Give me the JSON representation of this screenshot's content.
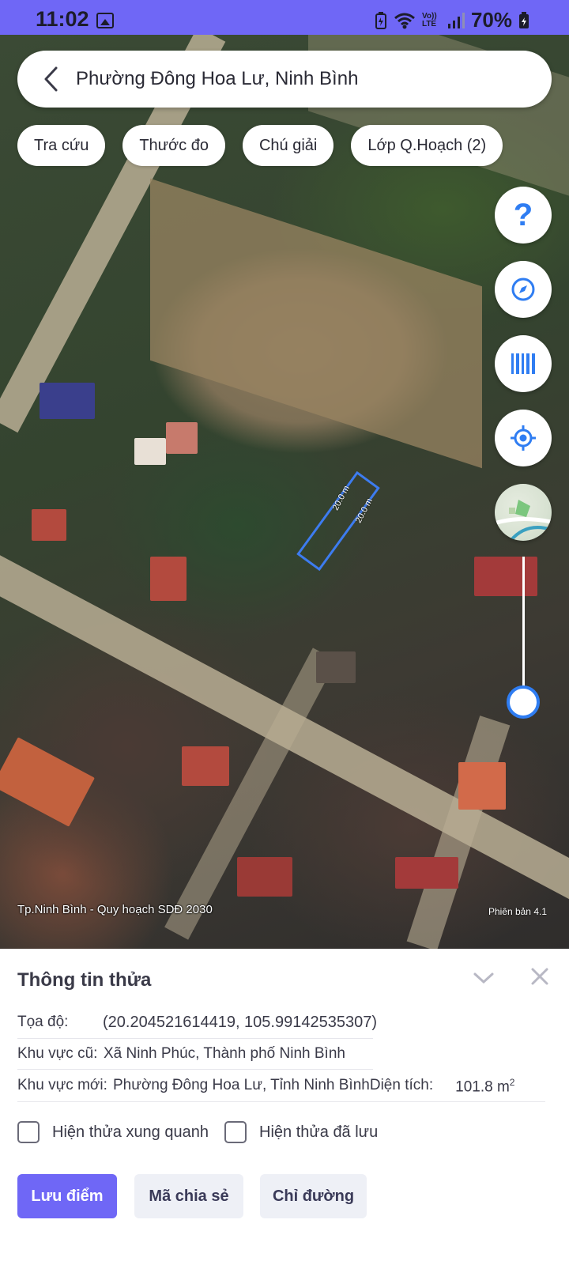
{
  "status_bar": {
    "time": "11:02",
    "volte_label": "Vo)) LTE",
    "battery": "70%"
  },
  "search": {
    "location": "Phường Đông Hoa Lư, Ninh Bình"
  },
  "chips": [
    {
      "label": "Tra cứu"
    },
    {
      "label": "Thước đo"
    },
    {
      "label": "Chú giải"
    },
    {
      "label": "Lớp Q.Hoạch (2)"
    }
  ],
  "map": {
    "parcel_edge_long": "20.0 m",
    "parcel_edge_side": "20.0 m",
    "plan_name": "Tp.Ninh Bình - Quy hoạch SDĐ 2030",
    "version": "Phiên bản 4.1",
    "overlay_opacity": 0.05,
    "parcel_color": "#3d7cf0"
  },
  "sheet": {
    "title": "Thông tin thửa",
    "coord_label": "Tọa độ:",
    "coord_value": "(20.204521614419, 105.99142535307)",
    "old_area_label": "Khu vực cũ:",
    "old_area_value": "Xã Ninh Phúc, Thành phố Ninh Bình",
    "new_area_label": "Khu vực mới:",
    "new_area_value": "Phường Đông Hoa Lư, Tỉnh Ninh Bình",
    "area_label": "Diện tích:",
    "area_value": "101.8 m",
    "area_unit_sup": "2",
    "check_surrounding": "Hiện thửa xung quanh",
    "check_saved": "Hiện thửa đã lưu",
    "btn_save": "Lưu điểm",
    "btn_share": "Mã chia sẻ",
    "btn_directions": "Chỉ đường"
  },
  "colors": {
    "accent": "#6f67f6",
    "icon_blue": "#2f7df2"
  }
}
